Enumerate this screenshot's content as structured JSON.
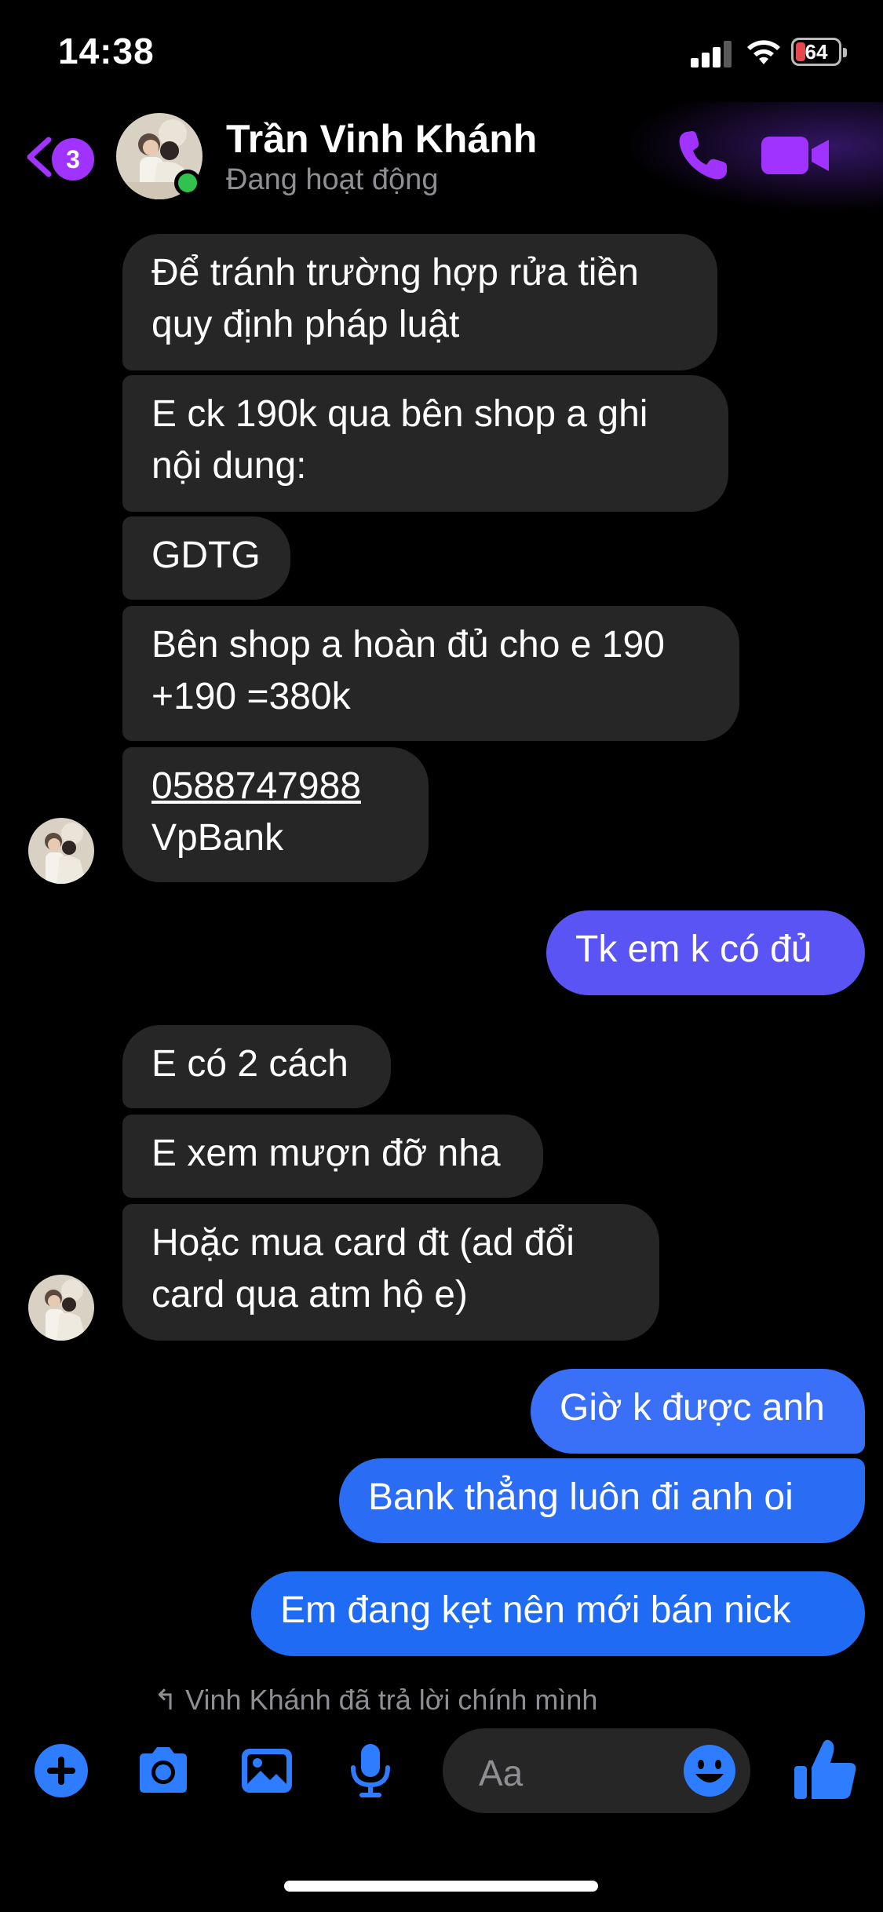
{
  "status_bar": {
    "time": "14:38",
    "battery": "64"
  },
  "header": {
    "back_badge": "3",
    "name": "Trần Vinh Khánh",
    "status": "Đang hoạt động"
  },
  "messages": [
    {
      "dir": "in",
      "lines": [
        "Để tránh trường hợp rửa tiền",
        "quy định pháp luật"
      ]
    },
    {
      "dir": "in",
      "lines": [
        "E ck 190k qua bên shop a ghi",
        "nội dung:"
      ]
    },
    {
      "dir": "in",
      "lines": [
        "GDTG"
      ]
    },
    {
      "dir": "in",
      "lines": [
        "Bên shop a hoàn đủ cho e 190",
        "+190 =380k"
      ]
    },
    {
      "dir": "in",
      "lines": [
        "0588747988",
        "VpBank"
      ]
    },
    {
      "dir": "out",
      "lines": [
        "Tk em k có đủ"
      ]
    },
    {
      "dir": "in",
      "lines": [
        "E có 2 cách"
      ]
    },
    {
      "dir": "in",
      "lines": [
        "E xem mượn đỡ nha"
      ]
    },
    {
      "dir": "in",
      "lines": [
        "Hoặc mua card đt (ad đổi",
        "card qua atm hộ e)"
      ]
    },
    {
      "dir": "out",
      "lines": [
        "Giờ k được anh"
      ]
    },
    {
      "dir": "out",
      "lines": [
        "Bank thẳng luôn đi anh oi"
      ]
    },
    {
      "dir": "out",
      "lines": [
        "Em đang kẹt nên mới bán nick"
      ]
    }
  ],
  "reply_hint": "↰ Vinh Khánh đã trả lời chính mình",
  "composer": {
    "placeholder": "Aa",
    "icons": [
      "plus-icon",
      "camera-icon",
      "image-icon",
      "microphone-icon",
      "emoji-icon",
      "thumbs-up-icon"
    ]
  },
  "colors": {
    "incoming_bubble": "#262626",
    "outgoing_gradient": [
      "#5b55f6",
      "#1f6bf3"
    ],
    "accent_purple": "#a033ff",
    "composer_blue": "#2e7cff",
    "online_green": "#31c24d"
  }
}
